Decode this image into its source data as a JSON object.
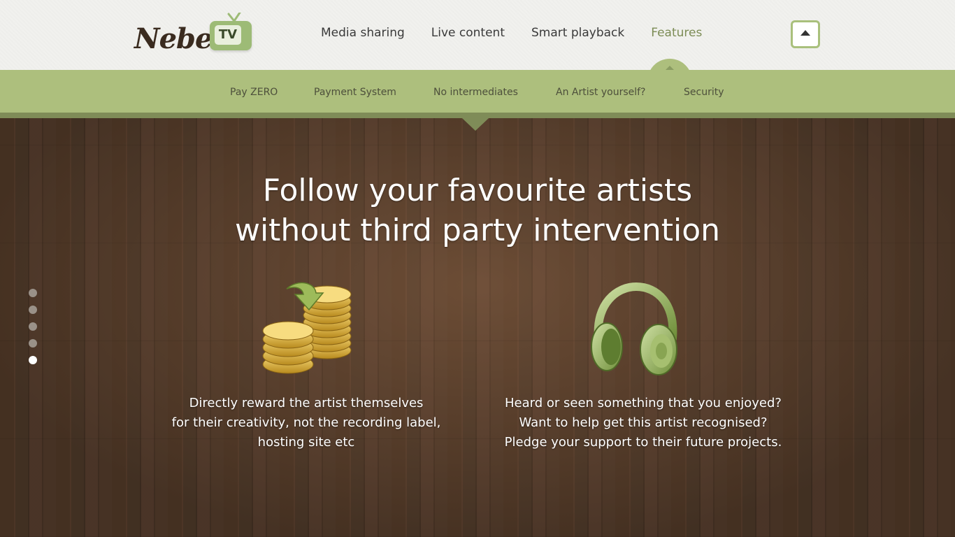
{
  "header": {
    "logo_text": "Nebel.",
    "logo_tv": "TV",
    "nav": [
      {
        "label": "Media sharing"
      },
      {
        "label": "Live content"
      },
      {
        "label": "Smart playback"
      },
      {
        "label": "Features",
        "active": true
      }
    ],
    "scroll_top_icon": "arrow-up-icon"
  },
  "subnav": {
    "items": [
      {
        "label": "Pay ZERO"
      },
      {
        "label": "Payment System"
      },
      {
        "label": "No intermediates",
        "active": true
      },
      {
        "label": "An Artist yourself?"
      },
      {
        "label": "Security"
      }
    ]
  },
  "hero": {
    "headline_line1": "Follow your favourite artists",
    "headline_line2": "without third party intervention",
    "slide_dots": {
      "count": 5,
      "active_index": 4
    },
    "features": [
      {
        "icon": "coins-icon",
        "lines": [
          "Directly reward the artist themselves",
          "for their creativity, not the recording label,",
          "hosting site etc"
        ]
      },
      {
        "icon": "headphones-icon",
        "lines": [
          "Heard or seen something that you enjoyed?",
          "Want to help get this artist recognised?",
          "Pledge your support to their future projects."
        ]
      }
    ]
  },
  "colors": {
    "accent_green": "#adbf7d",
    "dark_green": "#7f8c58",
    "wood": "#5a3f2a",
    "header_bg": "#f1f1ee"
  }
}
